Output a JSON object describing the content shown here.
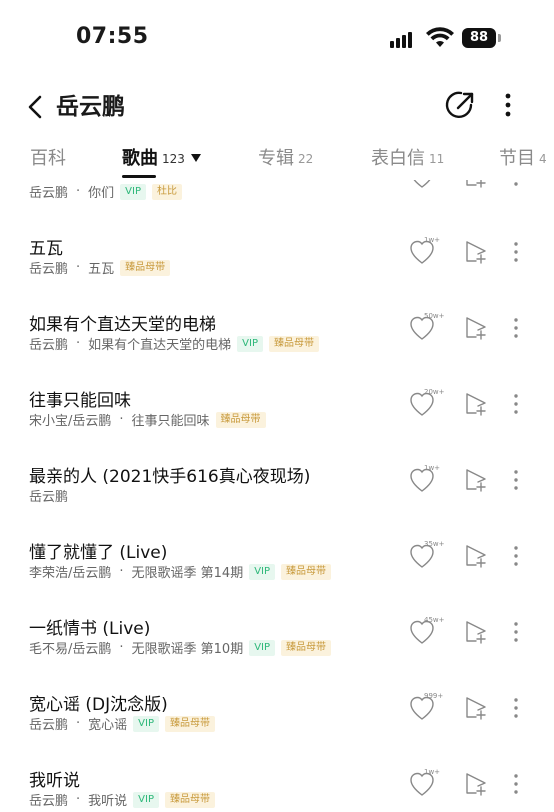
{
  "status": {
    "time": "07:55",
    "battery": "88"
  },
  "header": {
    "title": "岳云鹏"
  },
  "tabs": [
    {
      "label": "百科",
      "count": ""
    },
    {
      "label": "歌曲",
      "count": "123"
    },
    {
      "label": "专辑",
      "count": "22"
    },
    {
      "label": "表白信",
      "count": "11"
    },
    {
      "label": "节目",
      "count": "4"
    }
  ],
  "songs": [
    {
      "title": "",
      "artist": "岳云鹏",
      "album": "你们",
      "tags": [
        "VIP",
        "杜比"
      ],
      "likes": ""
    },
    {
      "title": "五瓦",
      "artist": "岳云鹏",
      "album": "五瓦",
      "tags": [
        "臻品母带"
      ],
      "likes": "1w+"
    },
    {
      "title": "如果有个直达天堂的电梯",
      "artist": "岳云鹏",
      "album": "如果有个直达天堂的电梯",
      "tags": [
        "VIP",
        "臻品母带"
      ],
      "likes": "50w+"
    },
    {
      "title": "往事只能回味",
      "artist": "宋小宝/岳云鹏",
      "album": "往事只能回味",
      "tags": [
        "臻品母带"
      ],
      "likes": "20w+"
    },
    {
      "title": "最亲的人 (2021快手616真心夜现场)",
      "artist": "岳云鹏",
      "album": "",
      "tags": [],
      "likes": "1w+"
    },
    {
      "title": "懂了就懂了 (Live)",
      "artist": "李荣浩/岳云鹏",
      "album": "无限歌谣季 第14期",
      "tags": [
        "VIP",
        "臻品母带"
      ],
      "likes": "35w+"
    },
    {
      "title": "一纸情书 (Live)",
      "artist": "毛不易/岳云鹏",
      "album": "无限歌谣季 第10期",
      "tags": [
        "VIP",
        "臻品母带"
      ],
      "likes": "45w+"
    },
    {
      "title": "宽心谣 (DJ沈念版)",
      "artist": "岳云鹏",
      "album": "宽心谣",
      "tags": [
        "VIP",
        "臻品母带"
      ],
      "likes": "999+"
    },
    {
      "title": "我听说",
      "artist": "岳云鹏",
      "album": "我听说",
      "tags": [
        "VIP",
        "臻品母带"
      ],
      "likes": "1w+"
    }
  ]
}
